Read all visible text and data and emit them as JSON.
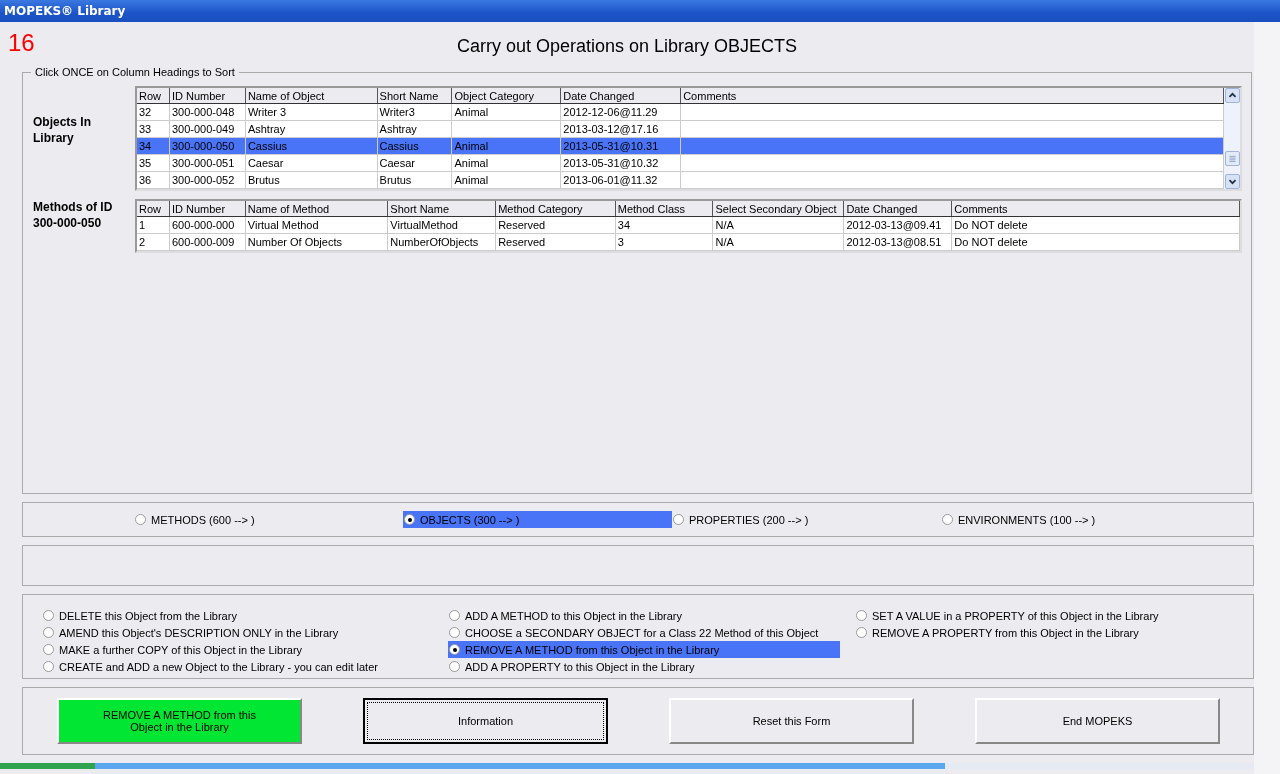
{
  "window": {
    "title": "MOPEKS® Library"
  },
  "page_number": "16",
  "heading": "Carry out Operations on Library OBJECTS",
  "sort_hint": "Click ONCE on Column Headings to Sort",
  "objects_label": "Objects In Library",
  "objects_table": {
    "columns": [
      "Row",
      "ID Number",
      "Name of Object",
      "Short Name",
      "Object Category",
      "Date Changed",
      "Comments"
    ],
    "rows": [
      {
        "cells": [
          "32",
          "300-000-048",
          "Writer 3",
          "Writer3",
          "Animal",
          "2012-12-06@11.29",
          ""
        ],
        "selected": false
      },
      {
        "cells": [
          "33",
          "300-000-049",
          "Ashtray",
          "Ashtray",
          "",
          "2013-03-12@17.16",
          ""
        ],
        "selected": false
      },
      {
        "cells": [
          "34",
          "300-000-050",
          "Cassius",
          "Cassius",
          "Animal",
          "2013-05-31@10.31",
          ""
        ],
        "selected": true
      },
      {
        "cells": [
          "35",
          "300-000-051",
          "Caesar",
          "Caesar",
          "Animal",
          "2013-05-31@10.32",
          ""
        ],
        "selected": false
      },
      {
        "cells": [
          "36",
          "300-000-052",
          "Brutus",
          "Brutus",
          "Animal",
          "2013-06-01@11.32",
          ""
        ],
        "selected": false
      }
    ]
  },
  "methods_label": [
    "Methods of ID",
    "300-000-050"
  ],
  "methods_table": {
    "columns": [
      "Row",
      "ID Number",
      "Name of Method",
      "Short Name",
      "Method Category",
      "Method Class",
      "Select Secondary Object",
      "Date Changed",
      "Comments"
    ],
    "rows": [
      {
        "cells": [
          "1",
          "600-000-000",
          "Virtual Method",
          "VirtualMethod",
          "Reserved",
          "34",
          "N/A",
          "2012-03-13@09.41",
          "Do NOT delete"
        ]
      },
      {
        "cells": [
          "2",
          "600-000-009",
          "Number Of Objects",
          "NumberOfObjects",
          "Reserved",
          "3",
          "N/A",
          "2012-03-13@08.51",
          "Do NOT delete"
        ]
      }
    ]
  },
  "library_types": [
    {
      "label": "METHODS (600 --> )",
      "selected": false
    },
    {
      "label": "OBJECTS (300 --> )",
      "selected": true
    },
    {
      "label": "PROPERTIES (200 --> )",
      "selected": false
    },
    {
      "label": "ENVIRONMENTS (100 --> )",
      "selected": false
    }
  ],
  "operations": [
    [
      {
        "label": "DELETE this Object from the Library",
        "selected": false
      },
      {
        "label": "AMEND this Object's DESCRIPTION ONLY in the Library",
        "selected": false
      },
      {
        "label": "MAKE a further COPY of this Object in the Library",
        "selected": false
      },
      {
        "label": "CREATE and ADD a new Object to the Library - you can edit later",
        "selected": false
      }
    ],
    [
      {
        "label": "ADD A METHOD to this Object in the Library",
        "selected": false
      },
      {
        "label": "CHOOSE a SECONDARY OBJECT for a Class 22 Method of this Object",
        "selected": false
      },
      {
        "label": "REMOVE A METHOD from this Object in the Library",
        "selected": true
      },
      {
        "label": "ADD A PROPERTY to this Object in the Library",
        "selected": false
      }
    ],
    [
      {
        "label": "SET A VALUE in a PROPERTY of this Object in the Library",
        "selected": false
      },
      {
        "label": "REMOVE A PROPERTY from this Object in the Library",
        "selected": false
      }
    ]
  ],
  "buttons": [
    {
      "label": "REMOVE A METHOD from this Object in the Library",
      "kind": "action"
    },
    {
      "label": "Information",
      "kind": "default"
    },
    {
      "label": "Reset this Form",
      "kind": "normal"
    },
    {
      "label": "End MOPEKS",
      "kind": "normal"
    }
  ]
}
